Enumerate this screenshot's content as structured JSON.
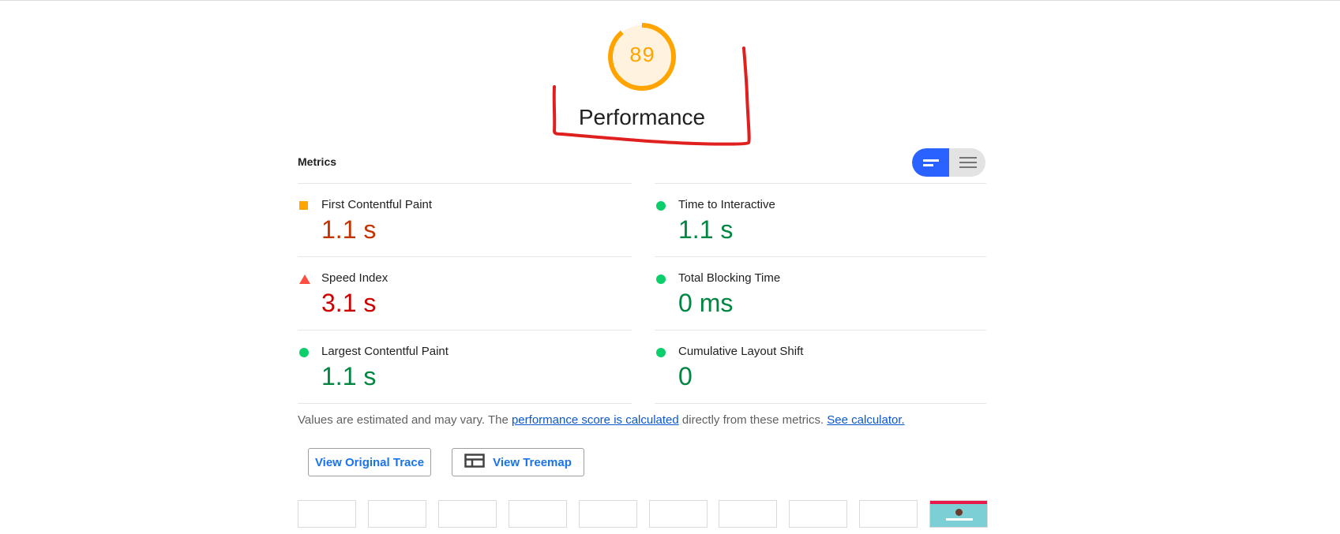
{
  "gauge": {
    "score": "89",
    "score_fraction": 0.89,
    "title": "Performance",
    "color": "#ffa400"
  },
  "metrics": {
    "title": "Metrics",
    "left": [
      {
        "name": "First Contentful Paint",
        "value": "1.1 s",
        "indicator": "square-average-icon"
      },
      {
        "name": "Speed Index",
        "value": "3.1 s",
        "indicator": "triangle-fail-icon"
      },
      {
        "name": "Largest Contentful Paint",
        "value": "1.1 s",
        "indicator": "circle-pass-icon"
      }
    ],
    "right": [
      {
        "name": "Time to Interactive",
        "value": "1.1 s",
        "indicator": "circle-pass-icon"
      },
      {
        "name": "Total Blocking Time",
        "value": "0 ms",
        "indicator": "circle-pass-icon"
      },
      {
        "name": "Cumulative Layout Shift",
        "value": "0",
        "indicator": "circle-pass-icon"
      }
    ]
  },
  "note": {
    "prefix": "Values are estimated and may vary. The ",
    "link1": "performance score is calculated",
    "middle": " directly from these metrics. ",
    "link2": "See calculator."
  },
  "buttons": {
    "trace": "View Original Trace",
    "treemap": "View Treemap"
  },
  "colors": {
    "pass": "#0cce6b",
    "average": "#ffa400",
    "fail": "#ff4e42",
    "accent": "#2962ff",
    "annotation": "#e0201f"
  }
}
